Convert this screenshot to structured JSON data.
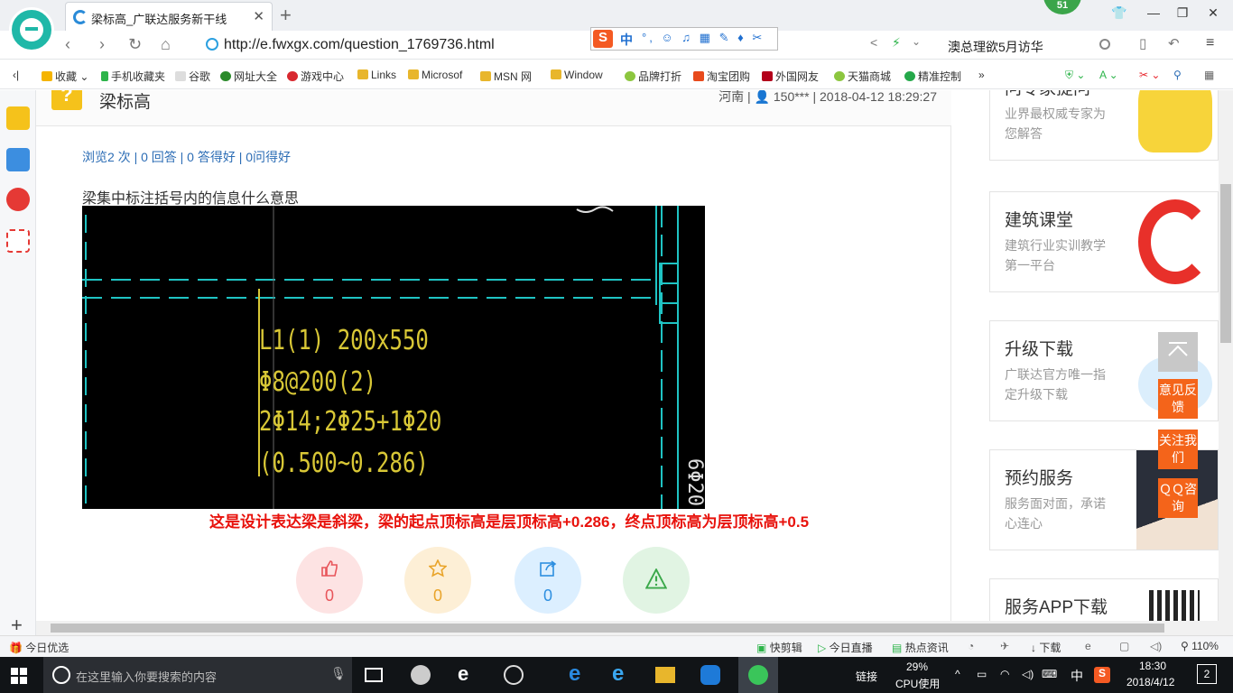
{
  "browser": {
    "tab_title": "梁标高_广联达服务新干线",
    "address": "http://e.fwxgx.com/question_1769736.html",
    "search_text": "澳总理欲5月访华",
    "notification_count": "51",
    "ime": {
      "lang": "中",
      "tools": "°, ☺ ♫ ▦ ✎ ♦ ✂"
    }
  },
  "bookmarks": [
    {
      "label": "收藏",
      "color": "#f5b400"
    },
    {
      "label": "手机收藏夹",
      "color": "#2db44a"
    },
    {
      "label": "谷歌",
      "color": "#cccccc"
    },
    {
      "label": "网址大全",
      "color": "#2a8a2a"
    },
    {
      "label": "游戏中心",
      "color": "#d8282f"
    },
    {
      "label": "Links",
      "color": "#e8b62c"
    },
    {
      "label": "Microsof",
      "color": "#e8b62c"
    },
    {
      "label": "MSN 网",
      "color": "#e8b62c"
    },
    {
      "label": "Window",
      "color": "#e8b62c"
    },
    {
      "label": "品牌打折",
      "color": "#8cc63f"
    },
    {
      "label": "淘宝团购",
      "color": "#e84a1c"
    },
    {
      "label": "外国网友",
      "color": "#b3001b"
    },
    {
      "label": "天猫商城",
      "color": "#8cc63f"
    },
    {
      "label": "精准控制",
      "color": "#25a84a"
    }
  ],
  "question": {
    "title": "梁标高",
    "meta": "河南 | 👤 150*** | 2018-04-12 18:29:27",
    "stats": "浏览2 次 | 0 回答 | 0 答得好 | 0问得好",
    "body": "梁集中标注括号内的信息什么意思",
    "cad_lines": [
      "L1(1) 200x550",
      "Φ8@200(2)",
      "2Φ14;2Φ25+1Φ20",
      "(0.500~0.286)"
    ],
    "answer": "这是设计表达梁是斜梁，梁的起点顶标高是层顶标高+0.286，终点顶标高为层顶标高+0.5"
  },
  "actions": [
    {
      "name": "like",
      "count": "0",
      "bg": "#fde3e3",
      "color": "#e8555a"
    },
    {
      "name": "favorite",
      "count": "0",
      "bg": "#fdefd6",
      "color": "#e9a42a"
    },
    {
      "name": "share",
      "count": "0",
      "bg": "#dcefff",
      "color": "#2e8fe0"
    },
    {
      "name": "report",
      "count": "",
      "bg": "#e1f4e3",
      "color": "#3aa84a"
    }
  ],
  "sidebar_promos": [
    {
      "title": "问专家提问",
      "desc": "业界最权威专家为您解答"
    },
    {
      "title": "建筑课堂",
      "desc": "建筑行业实训教学第一平台"
    },
    {
      "title": "升级下载",
      "desc": "广联达官方唯一指定升级下载"
    },
    {
      "title": "预约服务",
      "desc": "服务面对面，承诺心连心"
    },
    {
      "title": "服务APP下载",
      "desc": ""
    }
  ],
  "float_tools": {
    "feedback": "意见反馈",
    "follow": "关注我们",
    "qq": "ＱＱ咨询"
  },
  "statusbar": {
    "left": "今日优选",
    "items": [
      "快剪辑",
      "今日直播",
      "热点资讯",
      "下载"
    ],
    "zoom": "110%"
  },
  "taskbar": {
    "search_placeholder": "在这里输入你要搜索的内容",
    "link_label": "链接",
    "cpu_percent": "29%",
    "cpu_label": "CPU使用",
    "ime": "中",
    "time": "18:30",
    "date": "2018/4/12",
    "notifications": "2"
  }
}
